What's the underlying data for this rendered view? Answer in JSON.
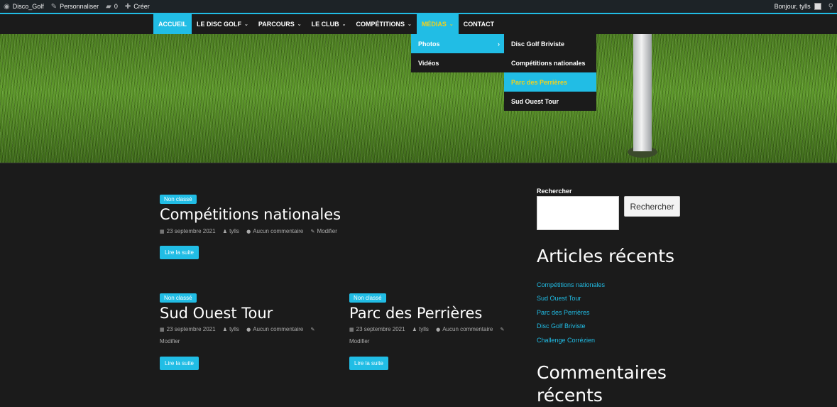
{
  "adminbar": {
    "site": "Disco_Golf",
    "customize": "Personnaliser",
    "comments_count": "0",
    "create": "Créer",
    "greeting": "Bonjour, tylls"
  },
  "nav": {
    "items": [
      {
        "label": "ACCUEIL"
      },
      {
        "label": "LE DISC GOLF"
      },
      {
        "label": "PARCOURS"
      },
      {
        "label": "LE CLUB"
      },
      {
        "label": "COMPÉTITIONS"
      },
      {
        "label": "MÉDIAS"
      },
      {
        "label": "CONTACT"
      }
    ],
    "submenu": [
      {
        "label": "Photos"
      },
      {
        "label": "Vidéos"
      }
    ],
    "photos_submenu": [
      {
        "label": "Disc Golf Briviste"
      },
      {
        "label": "Compétitions nationales"
      },
      {
        "label": "Parc des Perrières"
      },
      {
        "label": "Sud Ouest Tour"
      }
    ]
  },
  "posts": [
    {
      "category": "Non classé",
      "title": "Compétitions nationales",
      "date": "23 septembre 2021",
      "author": "tylls",
      "comments": "Aucun commentaire",
      "edit": "Modifier",
      "readmore": "Lire la suite"
    },
    {
      "category": "Non classé",
      "title": "Sud Ouest Tour",
      "date": "23 septembre 2021",
      "author": "tylls",
      "comments": "Aucun commentaire",
      "edit": "Modifier",
      "readmore": "Lire la suite"
    },
    {
      "category": "Non classé",
      "title": "Parc des Perrières",
      "date": "23 septembre 2021",
      "author": "tylls",
      "comments": "Aucun commentaire",
      "edit": "Modifier",
      "readmore": "Lire la suite"
    }
  ],
  "sidebar": {
    "search_label": "Rechercher",
    "search_value": "",
    "search_button": "Rechercher",
    "recent_title": "Articles récents",
    "recent": [
      {
        "label": "Compétitions nationales"
      },
      {
        "label": "Sud Ouest Tour"
      },
      {
        "label": "Parc des Perrières"
      },
      {
        "label": "Disc Golf Briviste"
      },
      {
        "label": "Challenge Corrézien"
      }
    ],
    "comments_title": "Commentaires récents"
  },
  "colors": {
    "accent": "#21bde5",
    "active_text": "#f2d11b",
    "background": "#1b1b1b"
  }
}
